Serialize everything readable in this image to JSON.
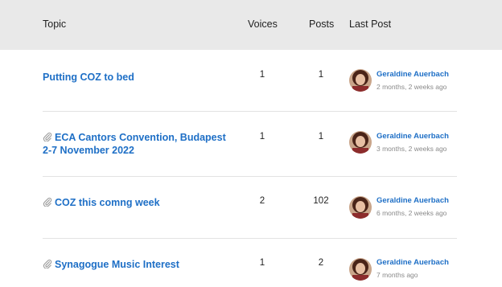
{
  "header": {
    "topic": "Topic",
    "voices": "Voices",
    "posts": "Posts",
    "last_post": "Last Post"
  },
  "topics": [
    {
      "title": "Putting COZ to bed",
      "has_attachment": false,
      "voices": "1",
      "posts": "1",
      "author": "Geraldine Auerbach",
      "time": "2 months, 2 weeks ago"
    },
    {
      "title": "ECA Cantors Convention, Budapest 2-7 November 2022",
      "has_attachment": true,
      "voices": "1",
      "posts": "1",
      "author": "Geraldine Auerbach",
      "time": "3 months, 2 weeks ago"
    },
    {
      "title": "COZ this comng week",
      "has_attachment": true,
      "voices": "2",
      "posts": "102",
      "author": "Geraldine Auerbach",
      "time": "6 months, 2 weeks ago"
    },
    {
      "title": "Synagogue Music Interest",
      "has_attachment": true,
      "voices": "1",
      "posts": "2",
      "author": "Geraldine Auerbach",
      "time": "7 months ago"
    }
  ],
  "icons": {
    "attachment": "paperclip-icon",
    "avatar": "user-avatar"
  },
  "colors": {
    "link": "#1e6fc6",
    "header_bg": "#e9e9e9",
    "meta_text": "#8a8a8a"
  }
}
